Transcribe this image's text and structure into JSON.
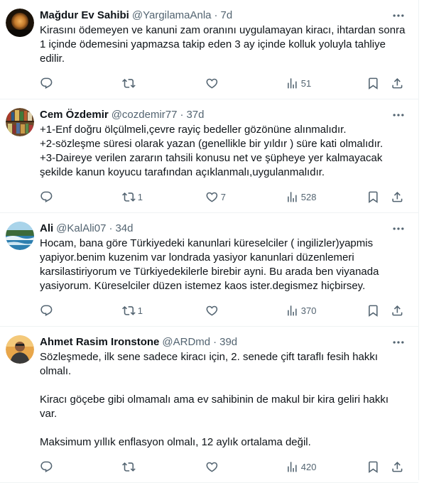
{
  "tweets": [
    {
      "name": "Mağdur Ev Sahibi",
      "handle": "@YargilamaAnla",
      "separator": "·",
      "time": "7d",
      "text": "Kirasını ödemeyen ve kanuni zam oranını uygulamayan kiracı, ihtardan sonra 1 içinde ödemesini yapmazsa takip eden 3 ay içinde kolluk yoluyla tahliye edilir.",
      "replies": "",
      "retweets": "",
      "likes": "",
      "views": "51",
      "avatar_icon": "moon-avatar"
    },
    {
      "name": "Cem Özdemir",
      "handle": "@cozdemir77",
      "separator": "·",
      "time": "37d",
      "text": "+1-Enf doğru ölçülmeli,çevre rayiç bedeller gözönüne alınmalıdır.\n+2-sözleşme süresi olarak yazan (genellikle bir yıldır ) süre kati olmalıdır.\n+3-Daireye verilen zararın tahsili konusu net ve şüpheye yer kalmayacak şekilde kanun koyucu tarafından açıklanmalı,uygulanmalıdır.",
      "replies": "",
      "retweets": "1",
      "likes": "7",
      "views": "528",
      "avatar_icon": "bookshelf-avatar"
    },
    {
      "name": "Ali",
      "handle": "@KalAli07",
      "separator": "·",
      "time": "34d",
      "text": "Hocam, bana göre Türkiyedeki kanunlari küreselciler ( ingilizler)yapmis yapiyor.benim kuzenim var londrada yasiyor kanunlari düzenlemeri karsilastiriyorum ve Türkiyedekilerle birebir ayni. Bu arada ben viyanada yasiyorum. Küreselciler düzen istemez kaos ister.degismez hiçbirsey.",
      "replies": "",
      "retweets": "1",
      "likes": "",
      "views": "370",
      "avatar_icon": "waterfall-avatar"
    },
    {
      "name": "Ahmet Rasim Ironstone",
      "handle": "@ARDmd",
      "separator": "·",
      "time": "39d",
      "text": "Sözleşmede, ilk sene sadece kiracı için, 2. senede çift taraflı fesih hakkı olmalı.\n\nKiracı göçebe gibi olmamalı ama ev sahibinin de makul bir kira geliri hakkı var.\n\nMaksimum yıllık enflasyon olmalı, 12 aylık ortalama değil.",
      "replies": "",
      "retweets": "",
      "likes": "",
      "views": "420",
      "avatar_icon": "person-avatar"
    }
  ]
}
